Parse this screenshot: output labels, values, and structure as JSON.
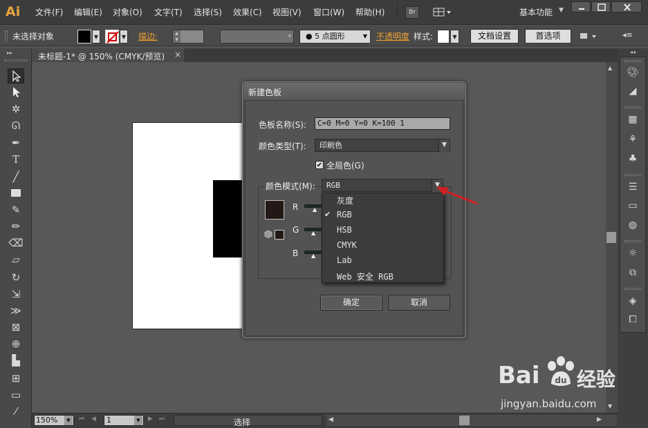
{
  "app": {
    "logo": "Ai",
    "workspace": "基本功能"
  },
  "menu": [
    "文件(F)",
    "编辑(E)",
    "对象(O)",
    "文字(T)",
    "选择(S)",
    "效果(C)",
    "视图(V)",
    "窗口(W)",
    "帮助(H)"
  ],
  "menubar_buttons": {
    "bridge": "Br"
  },
  "control_bar": {
    "selection": "未选择对象",
    "stroke_label": "描边:",
    "brush_value": "● 5 点圆形",
    "opacity_label": "不透明度",
    "style_label": "样式:",
    "doc_setup": "文档设置",
    "preferences": "首选项"
  },
  "document_tab": {
    "title": "未标题-1* @ 150% (CMYK/预览)",
    "close": "×"
  },
  "status_bar": {
    "zoom": "150%",
    "page": "1",
    "tool": "选择"
  },
  "dialog": {
    "title": "新建色板",
    "name_label": "色板名称(S):",
    "name_value": "C=0 M=0 Y=0 K=100 1",
    "type_label": "颜色类型(T):",
    "type_value": "印刷色",
    "global_label": "全局色(G)",
    "global_checked": true,
    "mode_label": "颜色模式(M):",
    "mode_value": "RGB",
    "channels": [
      "R",
      "G",
      "B"
    ],
    "ok": "确定",
    "cancel": "取消"
  },
  "mode_options": [
    "灰度",
    "RGB",
    "HSB",
    "CMYK",
    "Lab",
    "Web 安全 RGB"
  ],
  "mode_selected_index": 1,
  "watermark": {
    "brand_left": "Bai",
    "brand_right": "经验",
    "url": "jingyan.baidu.com"
  },
  "colors": {
    "accent_orange": "#e8a640",
    "arrow_red": "#d42020",
    "swatch": "#231815"
  }
}
